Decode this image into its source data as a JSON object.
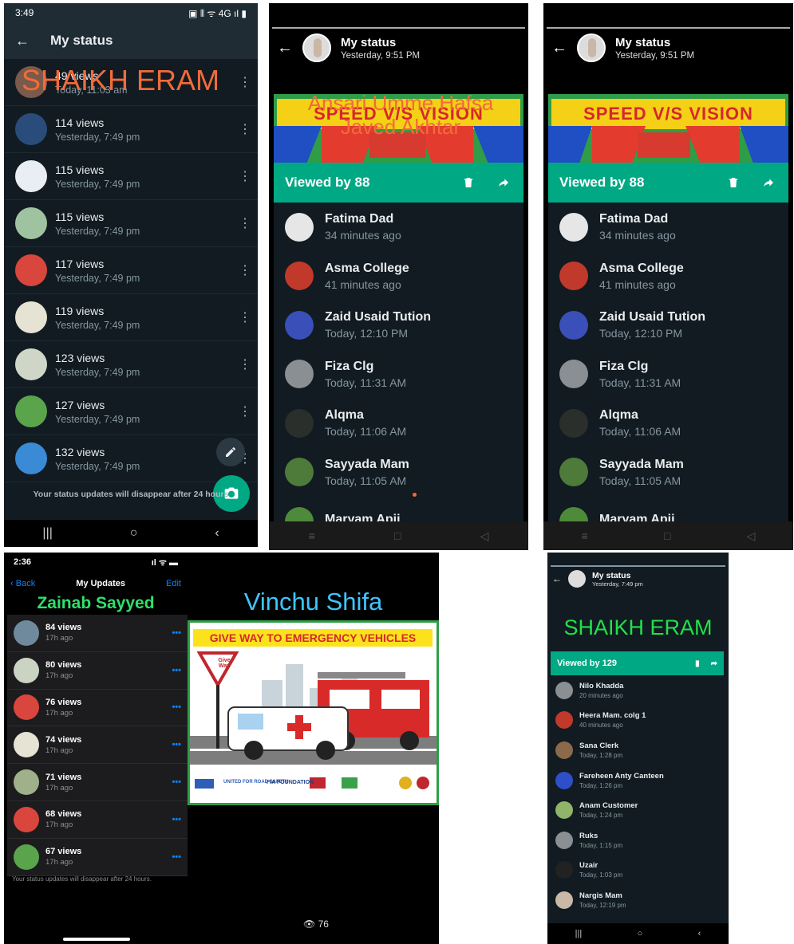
{
  "panel1": {
    "status_bar": {
      "time": "3:49",
      "right": "▣ ⦀ ᯤ 4G ıl ▮"
    },
    "header": {
      "title": "My status"
    },
    "overlay_text": "SHAIKH ERAM",
    "rows": [
      {
        "views": "49 views",
        "time": "Today, 11:03 am",
        "thumb": "#7a5a4a"
      },
      {
        "views": "114 views",
        "time": "Yesterday, 7:49 pm",
        "thumb": "#2a4c7a"
      },
      {
        "views": "115 views",
        "time": "Yesterday, 7:49 pm",
        "thumb": "#e9eef5"
      },
      {
        "views": "115 views",
        "time": "Yesterday, 7:49 pm",
        "thumb": "#9fc3a0"
      },
      {
        "views": "117 views",
        "time": "Yesterday, 7:49 pm",
        "thumb": "#d8463e"
      },
      {
        "views": "119 views",
        "time": "Yesterday, 7:49 pm",
        "thumb": "#e6e2d4"
      },
      {
        "views": "123 views",
        "time": "Yesterday, 7:49 pm",
        "thumb": "#cfd6c8"
      },
      {
        "views": "127 views",
        "time": "Yesterday, 7:49 pm",
        "thumb": "#5aa44c"
      },
      {
        "views": "132 views",
        "time": "Yesterday, 7:49 pm",
        "thumb": "#3a8ad6"
      }
    ],
    "footer": "Your status updates will disappear after 24 hours"
  },
  "panel2": {
    "header": {
      "title": "My status",
      "subtitle": "Yesterday, 9:51 PM"
    },
    "overlay_lines": [
      "Ansari Umme Hafsa",
      "Javed Akhtar"
    ],
    "banner_text": "SPEED V/S VISION",
    "viewed_by": "Viewed by 88",
    "viewers": [
      {
        "name": "Fatima Dad",
        "time": "34 minutes ago",
        "color": "#e6e6e6"
      },
      {
        "name": "Asma College",
        "time": "41 minutes ago",
        "color": "#c0392b"
      },
      {
        "name": "Zaid Usaid Tution",
        "time": "Today, 12:10 PM",
        "color": "#3b4fb8"
      },
      {
        "name": "Fiza Clg",
        "time": "Today, 11:31 AM",
        "color": "#8a8f93"
      },
      {
        "name": "Alqma",
        "time": "Today, 11:06 AM",
        "color": "#2a2f2b"
      },
      {
        "name": "Sayyada Mam",
        "time": "Today, 11:05 AM",
        "color": "#4e7a3a"
      },
      {
        "name": "Maryam Apii",
        "time": "",
        "color": "#4e8a3a"
      }
    ]
  },
  "panel3": {
    "header": {
      "title": "My status",
      "subtitle": "Yesterday, 9:51 PM"
    },
    "banner_text": "SPEED V/S VISION",
    "viewed_by": "Viewed by 88",
    "viewers": [
      {
        "name": "Fatima Dad",
        "time": "34 minutes ago",
        "color": "#e6e6e6"
      },
      {
        "name": "Asma College",
        "time": "41 minutes ago",
        "color": "#c0392b"
      },
      {
        "name": "Zaid Usaid Tution",
        "time": "Today, 12:10 PM",
        "color": "#3b4fb8"
      },
      {
        "name": "Fiza Clg",
        "time": "Today, 11:31 AM",
        "color": "#8a8f93"
      },
      {
        "name": "Alqma",
        "time": "Today, 11:06 AM",
        "color": "#2a2f2b"
      },
      {
        "name": "Sayyada Mam",
        "time": "Today, 11:05 AM",
        "color": "#4e7a3a"
      },
      {
        "name": "Maryam Apii",
        "time": "",
        "color": "#4e8a3a"
      }
    ]
  },
  "panel4": {
    "status_bar": {
      "time": "2:36",
      "right": "ıl ᯤ ▬"
    },
    "header": {
      "back": "Back",
      "title": "My Updates",
      "edit": "Edit"
    },
    "overlay_text": "Zainab Sayyed",
    "rows": [
      {
        "views": "84 views",
        "time": "17h ago",
        "thumb": "#6f8a9c"
      },
      {
        "views": "80 views",
        "time": "17h ago",
        "thumb": "#cbd4c2"
      },
      {
        "views": "76 views",
        "time": "17h ago",
        "thumb": "#d8463e"
      },
      {
        "views": "74 views",
        "time": "17h ago",
        "thumb": "#e6e2d4"
      },
      {
        "views": "71 views",
        "time": "17h ago",
        "thumb": "#9fb08a"
      },
      {
        "views": "68 views",
        "time": "17h ago",
        "thumb": "#d8463e"
      },
      {
        "views": "67 views",
        "time": "17h ago",
        "thumb": "#5aa44c"
      }
    ],
    "footer": "Your status updates will disappear after 24 hours."
  },
  "panel5": {
    "name": "Vinchu Shifa",
    "poster_title": "GIVE WAY TO EMERGENCY VEHICLES",
    "sign_text": "Give Way",
    "sponsors": [
      "UNITED FOR ROAD SAFETY",
      "FIA FOUNDATION"
    ],
    "views": "76"
  },
  "panel6": {
    "header": {
      "title": "My status",
      "subtitle": "Yesterday, 7:49 pm"
    },
    "name": "SHAIKH ERAM",
    "viewed_by": "Viewed by 129",
    "viewers": [
      {
        "name": "Nilo Khadda",
        "time": "20 minutes ago",
        "color": "#8a8f93"
      },
      {
        "name": "Heera Mam. colg 1",
        "time": "40 minutes ago",
        "color": "#c0392b"
      },
      {
        "name": "Sana Clerk",
        "time": "Today, 1:28 pm",
        "color": "#8a6a4a"
      },
      {
        "name": "Fareheen Anty Canteen",
        "time": "Today, 1:26 pm",
        "color": "#2e4fc8"
      },
      {
        "name": "Anam Customer",
        "time": "Today, 1:24 pm",
        "color": "#8fb46a"
      },
      {
        "name": "Ruks",
        "time": "Today, 1:15 pm",
        "color": "#8a8f93"
      },
      {
        "name": "Uzair",
        "time": "Today, 1:03 pm",
        "color": "#222"
      },
      {
        "name": "Nargis Mam",
        "time": "Today, 12:19 pm",
        "color": "#c9b7a8"
      }
    ]
  }
}
